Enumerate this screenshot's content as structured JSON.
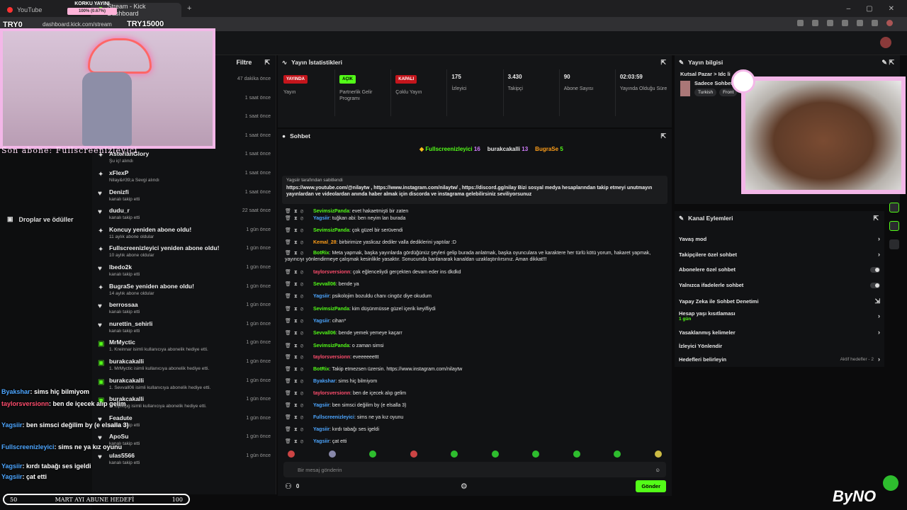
{
  "browser": {
    "tabs": [
      {
        "label": "YouTube",
        "active": false,
        "dot": "#ff3333"
      },
      {
        "label": "Stream - Kick Dashboard",
        "active": true,
        "dot": "#53fc18"
      }
    ],
    "url": "dashboard.kick.com/stream",
    "new_tab": "+",
    "window_controls": [
      "–",
      "▢",
      "✕"
    ]
  },
  "overlay": {
    "goal_title": "KORKU YAYINI",
    "goal_progress": "100% (0.67%)",
    "try_left": "TRY0",
    "try_right": "TRY15000",
    "last_sub": "Son abone: Fullscreenizleyici",
    "sub_goal": {
      "left": "50",
      "label": "MART AYI ABUNE HEDEFİ",
      "right": "100"
    },
    "watermark": "ByNO",
    "chat": [
      {
        "user": "Byakshar",
        "text": ": sims hiç bilmiyom",
        "color": "#4da6ff"
      },
      {
        "user": "taylorsversionn",
        "text": ": ben de içecek alıp gelim",
        "color": "#ff4d6d"
      },
      {
        "user": "Yagsiir",
        "text": ": ben simsci değilim by (e elsalla 3)",
        "color": "#4da6ff"
      },
      {
        "user": "Fullscreenizleyici",
        "text": ": sims ne ya kız oyunu",
        "color": "#4da6ff"
      },
      {
        "user": "Yagsiir",
        "text": ": kırdı tabağı ses igeldi",
        "color": "#4da6ff"
      },
      {
        "user": "Yagsiir",
        "text": ": çat etti",
        "color": "#4da6ff"
      }
    ]
  },
  "left": {
    "drops_label": "Droplar ve ödüller"
  },
  "feed": {
    "filter_label": "Filtre",
    "items": [
      {
        "name": "",
        "sub": "",
        "time": "47 dakika önce",
        "icon": ""
      },
      {
        "name": "",
        "sub": "",
        "time": "1 saat önce",
        "icon": ""
      },
      {
        "name": "",
        "sub": "",
        "time": "1 saat önce",
        "icon": ""
      },
      {
        "name": "",
        "sub": "",
        "time": "1 saat önce",
        "icon": ""
      },
      {
        "name": "AsterianGlory",
        "sub": "Şu iç! alındı",
        "time": "1 saat önce",
        "icon": "✦"
      },
      {
        "name": "xFlexP",
        "sub": "Nilay&#39;a Sevgi alındı",
        "time": "1 saat önce",
        "icon": "✦"
      },
      {
        "name": "Denizfi",
        "sub": "kanalı takip etti",
        "time": "1 saat önce",
        "icon": "♥"
      },
      {
        "name": "dudu_r",
        "sub": "kanalı takip etti",
        "time": "22 saat önce",
        "icon": "♥"
      },
      {
        "name": "Koncuy yeniden abone oldu!",
        "sub": "11 aylık abone oldular",
        "time": "1 gün önce",
        "icon": "✦"
      },
      {
        "name": "Fullscreenizleyici yeniden abone oldu!",
        "sub": "10 aylık abone oldular",
        "time": "1 gün önce",
        "icon": "✦"
      },
      {
        "name": "lbedo2k",
        "sub": "kanalı takip etti",
        "time": "1 gün önce",
        "icon": "♥"
      },
      {
        "name": "BugraSe yeniden abone oldu!",
        "sub": "14 aylık abone oldular",
        "time": "1 gün önce",
        "icon": "✦"
      },
      {
        "name": "berrossaa",
        "sub": "kanalı takip etti",
        "time": "1 gün önce",
        "icon": "♥"
      },
      {
        "name": "nurettin_sehirli",
        "sub": "kanalı takip etti",
        "time": "1 gün önce",
        "icon": "♥"
      },
      {
        "name": "MrMyctic",
        "sub": "1. Kreinnar isimli kullanıcıya abonelik hediye etti.",
        "time": "1 gün önce",
        "icon": "▣"
      },
      {
        "name": "burakcakalli",
        "sub": "1. MrMyctic isimli kullanıcıya abonelik hediye etti.",
        "time": "1 gün önce",
        "icon": "▣"
      },
      {
        "name": "burakcakalli",
        "sub": "1. Sevvall06 isimli kullanıcıya abonelik hediye etti.",
        "time": "1 gün önce",
        "icon": "▣"
      },
      {
        "name": "burakcakalli",
        "sub": "1. topikipg isimli kullanıcıya abonelik hediye etti.",
        "time": "1 gün önce",
        "icon": "▣"
      },
      {
        "name": "Feadute",
        "sub": "kanalı takip etti",
        "time": "1 gün önce",
        "icon": "♥"
      },
      {
        "name": "ApoSu",
        "sub": "kanalı takip etti",
        "time": "1 gün önce",
        "icon": "♥"
      },
      {
        "name": "ulas5566",
        "sub": "kanalı takip etti",
        "time": "1 gün önce",
        "icon": "♥"
      }
    ]
  },
  "stats": {
    "title": "Yayın İstatistikleri",
    "cells": [
      {
        "badge": "YAYINDA",
        "badge_color": "red",
        "label": "Yayın"
      },
      {
        "badge": "AÇIK",
        "badge_color": "green",
        "label": "Partnerlik Gelir Programı"
      },
      {
        "badge": "KAPALI",
        "badge_color": "red",
        "label": "Çoklu Yayın"
      },
      {
        "value": "175",
        "label": "İzleyici"
      },
      {
        "value": "3.430",
        "label": "Takipçi"
      },
      {
        "value": "90",
        "label": "Abone Sayısı"
      },
      {
        "value": "02:03:59",
        "label": "Yayında Olduğu Süre"
      }
    ]
  },
  "chat": {
    "title": "Sohbet",
    "top": [
      {
        "name": "Fullscreenizleyici",
        "count": "16"
      },
      {
        "name": "burakcakalli",
        "count": "13"
      },
      {
        "name": "BugraSe",
        "count": "5"
      }
    ],
    "pinned_by": "Yagsiir tarafından sabitlendi",
    "pinned_text": "https://www.youtube.com/@nilaytw , https://www.instagram.com/nilaytw/ , https://discord.gg/nilay Bizi sosyal medya hesaplarından takip etmeyi unutmayın yayınlardan ve videolardan anında haber almak için discorda ve instagrama gelebilirsiniz seviliyorsunuz",
    "messages": [
      {
        "user": "SevimsizPanda",
        "color": "#53fc18",
        "text": ": evet hakaetmişti bir zaten"
      },
      {
        "user": "Yagsiir",
        "color": "#4da6ff",
        "text": ": tuğkan abi: ben neyim lan burada"
      },
      {
        "user": "SevimsizPanda",
        "color": "#53fc18",
        "text": ": çok güzel bir serüvendi"
      },
      {
        "user": "Kemal_28",
        "color": "#ff9f1a",
        "text": ": birbirimize yaslicaz dediler valla dediklerini yaptılar :D"
      },
      {
        "user": "BotRix",
        "color": "#53fc18",
        "text": ": Meta yapmak, başka yayınlarda gördüğünüz şeyleri gelip burada anlatmak, başka oyunculara ve karaktere her türlü kötü yorum, hakaret yapmak, yayıncıyı yönlendirmeye çalışmak kesinlikle yasaktır. Sonucunda banlanarak kanaldan uzaklaştırılırsınız. Aman dikkat!!!"
      },
      {
        "user": "taylorsversionn",
        "color": "#ff4d6d",
        "text": ": çok eğlenceliydi gerçekten devam eder ins dkdkd"
      },
      {
        "user": "Sevvall06",
        "color": "#53fc18",
        "text": ": bende ya"
      },
      {
        "user": "Yagsiir",
        "color": "#4da6ff",
        "text": ": psikolojim bozuldu chanı cingöz diye okudum"
      },
      {
        "user": "SevimsizPanda",
        "color": "#53fc18",
        "text": ": kim düşünmüsse güzel içerik keyifliydi"
      },
      {
        "user": "Yagsiir",
        "color": "#4da6ff",
        "text": ": cihan*"
      },
      {
        "user": "Sevvall06",
        "color": "#53fc18",
        "text": ": bende yemek yemeye kaçarr"
      },
      {
        "user": "SevimsizPanda",
        "color": "#53fc18",
        "text": ": o zaman simsi"
      },
      {
        "user": "taylorsversionn",
        "color": "#ff4d6d",
        "text": ": eveeeeeettt"
      },
      {
        "user": "BotRix",
        "color": "#53fc18",
        "text": ": Takip etmezsen üzersin. https://www.instagram.com/nilaytw"
      },
      {
        "user": "Byakshar",
        "color": "#4da6ff",
        "text": ": sims hiç bilmiyom"
      },
      {
        "user": "taylorsversionn",
        "color": "#ff4d6d",
        "text": ": ben de içecek alıp gelim"
      },
      {
        "user": "Yagsiir",
        "color": "#4da6ff",
        "text": ": ben simsci değilim by (e elsalla 3)"
      },
      {
        "user": "Fullscreenizleyici",
        "color": "#4da6ff",
        "text": ": sims ne ya kız oyunu"
      },
      {
        "user": "Yagsiir",
        "color": "#4da6ff",
        "text": ": kırdı tabağı ses igeldi"
      },
      {
        "user": "Yagsiir",
        "color": "#4da6ff",
        "text": ": çat etti"
      }
    ],
    "placeholder": "Bir mesaj gönderin",
    "viewer_count": "0",
    "send_label": "Gönder"
  },
  "info": {
    "title": "Yayın bilgisi",
    "stream_title": "Kutsal Pazar > Idc li",
    "row_text": "Sadece Sohbet",
    "tags": [
      "Turkish",
      "Front"
    ]
  },
  "actions": {
    "title": "Kanal Eylemleri",
    "items": [
      {
        "label": "Yavaş mod",
        "kind": "arrow"
      },
      {
        "label": "Takipçilere özel sohbet",
        "kind": "arrow"
      },
      {
        "label": "Abonelere özel sohbet",
        "kind": "toggle"
      },
      {
        "label": "Yalnızca ifadelerle sohbet",
        "kind": "toggle"
      },
      {
        "label": "Yapay Zeka ile Sohbet Denetimi",
        "kind": "link"
      },
      {
        "label": "Hesap yaşı kısıtlaması",
        "kind": "arrow",
        "sub": "1 gün"
      },
      {
        "label": "Yasaklanmış kelimeler",
        "kind": "arrow"
      },
      {
        "label": "İzleyici Yönlendir",
        "kind": "none"
      },
      {
        "label": "Hedefleri belirleyin",
        "kind": "goal",
        "sub": "Aktif hedefler - 2"
      }
    ]
  }
}
